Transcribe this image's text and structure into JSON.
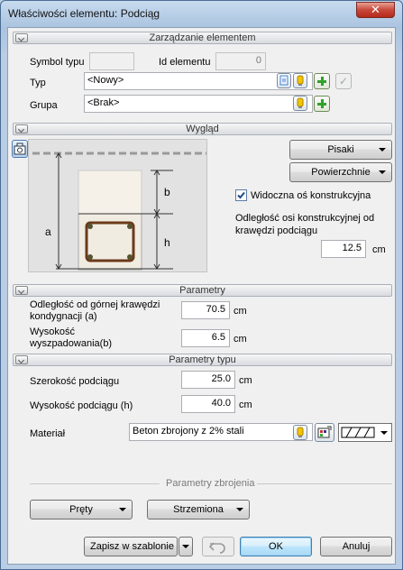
{
  "window": {
    "title": "Właściwości elementu: Podciąg",
    "close": "✕"
  },
  "management": {
    "header": "Zarządzanie elementem",
    "symbol_label": "Symbol typu",
    "symbol_value": "",
    "id_label": "Id elementu",
    "id_value": "0",
    "type_label": "Typ",
    "type_value": "<Nowy>",
    "group_label": "Grupa",
    "group_value": "<Brak>"
  },
  "appearance": {
    "header": "Wygląd",
    "pens_button": "Pisaki",
    "surfaces_button": "Powierzchnie",
    "axis_visible_label": "Widoczna oś konstrukcyjna",
    "axis_visible_checked": true,
    "axis_offset_label": "Odległość osi konstrukcyjnej od krawędzi podciągu",
    "axis_offset_value": "12.5",
    "axis_offset_unit": "cm",
    "preview_labels": {
      "a": "a",
      "b": "b",
      "h": "h"
    }
  },
  "parameters": {
    "header": "Parametry",
    "top_distance_label": "Odległość od górnej krawędzi kondygnacji (a)",
    "top_distance_value": "70.5",
    "top_distance_unit": "cm",
    "drop_height_label": "Wysokość wyszpadowania(b)",
    "drop_height_value": "6.5",
    "drop_height_unit": "cm"
  },
  "type_parameters": {
    "header": "Parametry typu",
    "width_label": "Szerokość podciągu",
    "width_value": "25.0",
    "width_unit": "cm",
    "height_label": "Wysokość podciągu (h)",
    "height_value": "40.0",
    "height_unit": "cm",
    "material_label": "Materiał",
    "material_value": "Beton zbrojony z 2% stali"
  },
  "reinforcement": {
    "header": "Parametry zbrojenia",
    "bars_button": "Pręty",
    "stirrups_button": "Strzemiona"
  },
  "footer": {
    "save_template": "Zapisz w szablonie",
    "ok": "OK",
    "cancel": "Anuluj"
  },
  "colors": {
    "accent": "#2f9a2a",
    "title_bar": "#b9cde4",
    "ok_focus": "#3c7fb1"
  }
}
